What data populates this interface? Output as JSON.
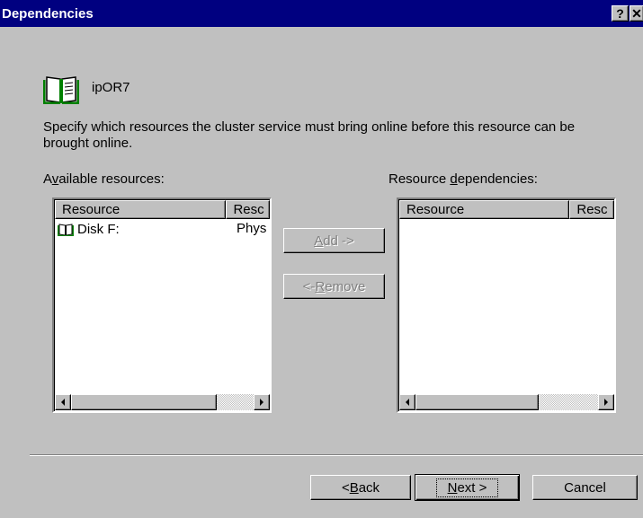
{
  "window": {
    "title": "Dependencies",
    "help_label": "?",
    "close_label": "✕"
  },
  "resource": {
    "name": "ipOR7",
    "icon": "book-icon"
  },
  "description": "Specify which resources the cluster service must bring online before this resource can be brought online.",
  "available": {
    "label_pre": "A",
    "label_accel": "v",
    "label_post": "ailable resources:",
    "columns": [
      "Resource",
      "Resc"
    ],
    "rows": [
      {
        "icon": "book-icon",
        "name": "Disk F:",
        "type": "Phys"
      }
    ]
  },
  "dependencies": {
    "label_pre": "Resource ",
    "label_accel": "d",
    "label_post": "ependencies:",
    "columns": [
      "Resource",
      "Resc"
    ],
    "rows": []
  },
  "buttons": {
    "add_accel": "A",
    "add_rest": "dd ->",
    "remove_pre": "<- ",
    "remove_accel": "R",
    "remove_rest": "emove",
    "back_pre": "< ",
    "back_accel": "B",
    "back_rest": "ack",
    "next_accel": "N",
    "next_rest": "ext >",
    "cancel": "Cancel"
  },
  "colors": {
    "titlebar": "#000080",
    "face": "#c0c0c0",
    "disabled_text": "#808080"
  }
}
